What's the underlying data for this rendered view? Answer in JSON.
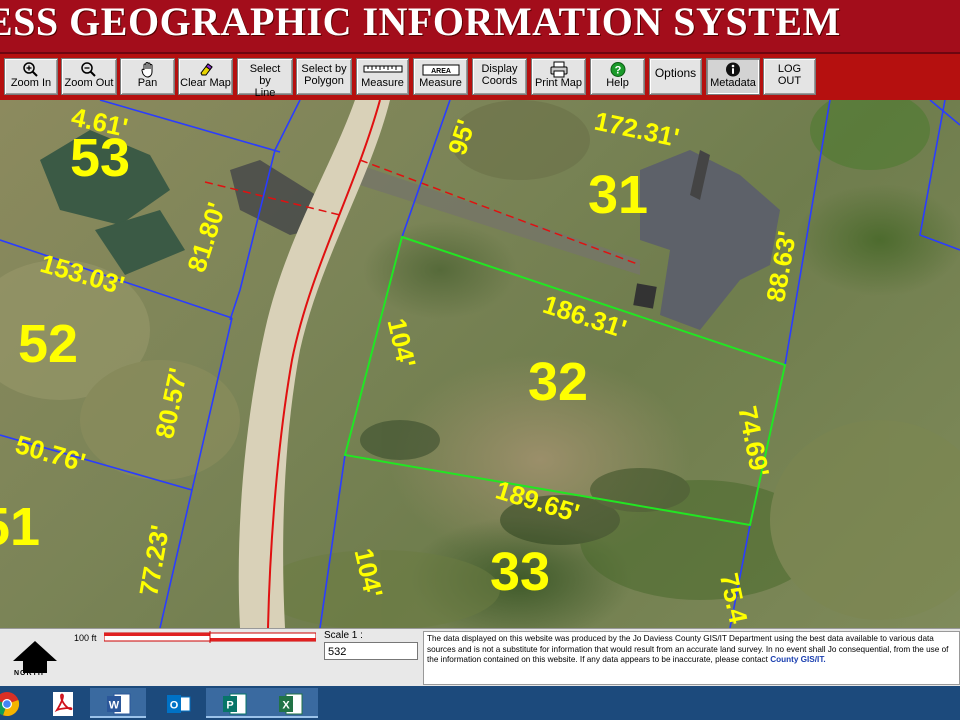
{
  "title": "ESS GEOGRAPHIC INFORMATION SYSTEM",
  "toolbar": [
    {
      "label": "Zoom In",
      "icon": "zoom-in-icon"
    },
    {
      "label": "Zoom Out",
      "icon": "zoom-out-icon"
    },
    {
      "label": "Pan",
      "icon": "hand-icon"
    },
    {
      "label": "Clear Map",
      "icon": "eraser-icon"
    },
    {
      "label": "Select by Line"
    },
    {
      "label": "Select by Polygon"
    },
    {
      "label": "Measure",
      "icon": "ruler-icon"
    },
    {
      "label": "Measure",
      "icon": "area-icon",
      "icon_text": "AREA"
    },
    {
      "label": "Display Coords"
    },
    {
      "label": "Print Map",
      "icon": "printer-icon"
    },
    {
      "label": "Help",
      "icon": "help-icon"
    },
    {
      "label": "Options"
    },
    {
      "label": "Metadata",
      "icon": "info-icon"
    },
    {
      "label": "LOG OUT"
    }
  ],
  "map": {
    "parcel_numbers": [
      "53",
      "52",
      "51",
      "31",
      "32",
      "33"
    ],
    "dimensions": [
      "4.61'",
      "81.80'",
      "153.03'",
      "80.57'",
      "50.76'",
      "77.23'",
      "95'",
      "172.31'",
      "88.63'",
      "186.31'",
      "104'",
      "74.69'",
      "189.65'",
      "104'",
      "75.4"
    ],
    "colors": {
      "parcel_line": "#2a3cff",
      "selected_parcel": "#22e622",
      "road_line": "#e01010",
      "label": "#ffff00"
    }
  },
  "bottom": {
    "north_label": "NORTH",
    "scale_distance": "100 ft",
    "scale_label": "Scale 1 :",
    "scale_value": "532",
    "disclaimer": "The data displayed on this website was produced by the Jo Daviess County GIS/IT Department using the best data available to various data sources and is not a substitute for information that would result from an accurate land survey. In no event shall Jo consequential, from the use of the information contained on this website. If any data appears to be inaccurate, please contact",
    "disclaimer_link": "County GIS/IT."
  },
  "taskbar": [
    {
      "app": "chrome-icon"
    },
    {
      "app": "pdf-icon",
      "letter": ""
    },
    {
      "app": "word-icon",
      "letter": "W"
    },
    {
      "app": "outlook-icon",
      "letter": "O"
    },
    {
      "app": "publisher-icon",
      "letter": "P"
    },
    {
      "app": "excel-icon",
      "letter": "X"
    }
  ]
}
